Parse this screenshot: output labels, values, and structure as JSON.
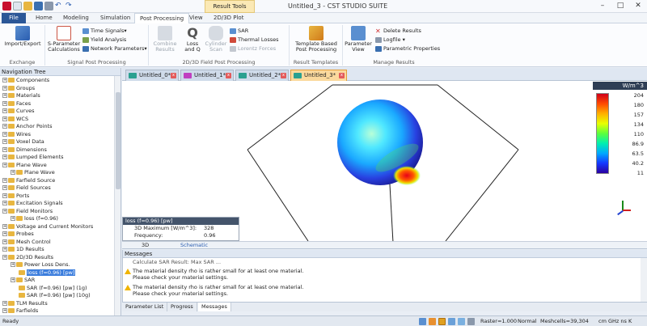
{
  "app": {
    "title": "Untitled_3 - CST STUDIO SUITE",
    "context_tab": "Result Tools"
  },
  "ribbon_tabs": [
    "File",
    "Home",
    "Modeling",
    "Simulation",
    "Post Processing",
    "View",
    "2D/3D Plot"
  ],
  "ribbon": {
    "exchange": {
      "label": "Exchange",
      "import_export": "Import/Export"
    },
    "signal": {
      "label": "Signal Post Processing",
      "sparam": "S-Parameter",
      "sparam2": "Calculations",
      "time_signals": "Time Signals",
      "yield": "Yield Analysis",
      "network": "Network Parameters"
    },
    "field": {
      "label": "2D/3D Field Post Processing",
      "combine": "Combine",
      "combine2": "Results",
      "loss": "Loss",
      "loss2": "and Q",
      "cylinder": "Cylinder",
      "cylinder2": "Scan",
      "sar": "SAR",
      "thermal": "Thermal Losses",
      "lorentz": "Lorentz Forces"
    },
    "templates": {
      "label": "Result Templates",
      "tbpp": "Template Based",
      "tbpp2": "Post Processing"
    },
    "manage": {
      "label": "Manage Results",
      "param_view": "Parameter",
      "param_view2": "View",
      "delete": "Delete Results",
      "logfile": "Logfile",
      "param_props": "Parametric Properties"
    }
  },
  "nav": {
    "title": "Navigation Tree",
    "items": [
      {
        "label": "Components",
        "level": 0
      },
      {
        "label": "Groups",
        "level": 0
      },
      {
        "label": "Materials",
        "level": 0
      },
      {
        "label": "Faces",
        "level": 0
      },
      {
        "label": "Curves",
        "level": 0
      },
      {
        "label": "WCS",
        "level": 0
      },
      {
        "label": "Anchor Points",
        "level": 0
      },
      {
        "label": "Wires",
        "level": 0
      },
      {
        "label": "Voxel Data",
        "level": 0
      },
      {
        "label": "Dimensions",
        "level": 0
      },
      {
        "label": "Lumped Elements",
        "level": 0
      },
      {
        "label": "Plane Wave",
        "level": 0
      },
      {
        "label": "Plane Wave",
        "level": 1
      },
      {
        "label": "Farfield Source",
        "level": 0
      },
      {
        "label": "Field Sources",
        "level": 0
      },
      {
        "label": "Ports",
        "level": 0
      },
      {
        "label": "Excitation Signals",
        "level": 0
      },
      {
        "label": "Field Monitors",
        "level": 0
      },
      {
        "label": "loss (f=0.96)",
        "level": 1
      },
      {
        "label": "Voltage and Current Monitors",
        "level": 0
      },
      {
        "label": "Probes",
        "level": 0
      },
      {
        "label": "Mesh Control",
        "level": 0
      },
      {
        "label": "1D Results",
        "level": 0
      },
      {
        "label": "2D/3D Results",
        "level": 0
      },
      {
        "label": "Power Loss Dens.",
        "level": 1
      },
      {
        "label": "loss (f=0.96) [pw]",
        "level": 2,
        "selected": true
      },
      {
        "label": "SAR",
        "level": 1
      },
      {
        "label": "SAR (f=0.96) [pw] (1g)",
        "level": 2
      },
      {
        "label": "SAR (f=0.96) [pw] (10g)",
        "level": 2
      },
      {
        "label": "TLM Results",
        "level": 0
      },
      {
        "label": "Farfields",
        "level": 0
      }
    ]
  },
  "doc_tabs": [
    "Untitled_0*",
    "Untitled_1*",
    "Untitled_2*",
    "Untitled_3*"
  ],
  "legend": {
    "unit": "W/m^3",
    "values": [
      "204",
      "180",
      "157",
      "134",
      "110",
      "86.9",
      "63.5",
      "40.2",
      "11"
    ]
  },
  "info": {
    "title": "loss (f=0.96) [pw]",
    "row1_label": "3D Maximum [W/m^3]:",
    "row1_value": "328",
    "row2_label": "Frequency:",
    "row2_value": "0.96"
  },
  "view_tabs": [
    "3D",
    "Schematic"
  ],
  "messages": {
    "title": "Messages",
    "lines": [
      {
        "text": "Calculate SAR Result: Max SAR ..."
      },
      {
        "text": "The material density rho is rather small for at least one material.",
        "sub": "Please check your material settings."
      },
      {
        "text": "The material density rho is rather small for at least one material.",
        "sub": "Please check your material settings."
      }
    ]
  },
  "bottom_tabs": [
    "Parameter List",
    "Progress",
    "Messages"
  ],
  "status": {
    "ready": "Ready",
    "raster": "Raster=1.000",
    "mode": "Normal",
    "meshcells": "Meshcells=39,304",
    "units": "cm  GHz  ns  K"
  }
}
